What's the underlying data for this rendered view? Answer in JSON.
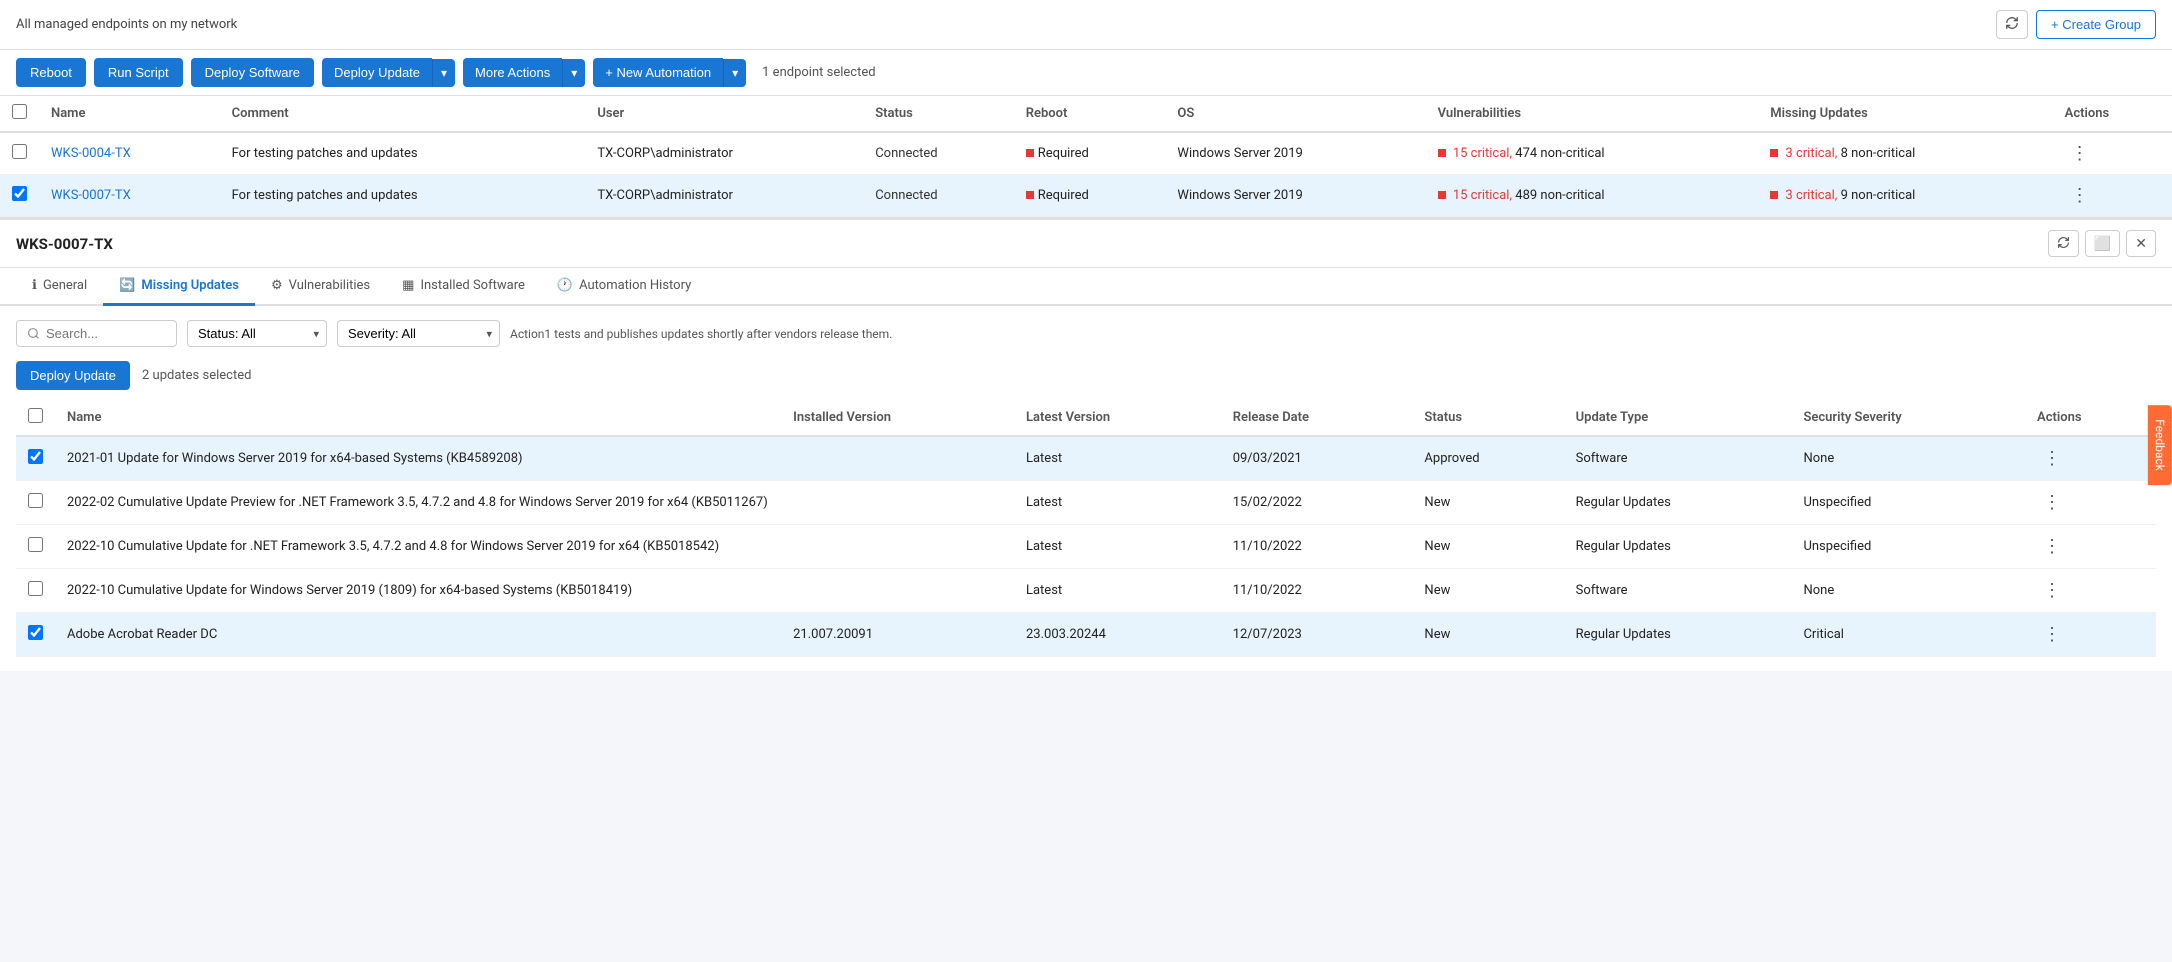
{
  "topbar": {
    "title": "All managed endpoints on my network",
    "create_group_label": "+ Create Group",
    "refresh_tooltip": "Refresh"
  },
  "toolbar": {
    "reboot_label": "Reboot",
    "run_script_label": "Run Script",
    "deploy_software_label": "Deploy Software",
    "deploy_update_label": "Deploy Update",
    "more_actions_label": "More Actions",
    "new_automation_label": "+ New Automation",
    "endpoint_selected": "1 endpoint selected"
  },
  "main_table": {
    "columns": [
      "",
      "Name",
      "Comment",
      "User",
      "Status",
      "Reboot",
      "OS",
      "Vulnerabilities",
      "Missing Updates",
      "Actions"
    ],
    "rows": [
      {
        "id": "WKS-0004-TX",
        "comment": "For testing patches and updates",
        "user": "TX-CORP\\administrator",
        "status": "Connected",
        "reboot": "Required",
        "os": "Windows Server 2019",
        "vuln_critical": "15 critical,",
        "vuln_noncritical": "474 non-critical",
        "missing_critical": "3 critical,",
        "missing_noncritical": "8 non-critical",
        "selected": false
      },
      {
        "id": "WKS-0007-TX",
        "comment": "For testing patches and updates",
        "user": "TX-CORP\\administrator",
        "status": "Connected",
        "reboot": "Required",
        "os": "Windows Server 2019",
        "vuln_critical": "15 critical,",
        "vuln_noncritical": "489 non-critical",
        "missing_critical": "3 critical,",
        "missing_noncritical": "9 non-critical",
        "selected": true
      }
    ]
  },
  "detail_panel": {
    "title": "WKS-0007-TX",
    "tabs": [
      {
        "id": "general",
        "label": "General",
        "icon": "ℹ️"
      },
      {
        "id": "missing_updates",
        "label": "Missing Updates",
        "icon": "🔄"
      },
      {
        "id": "vulnerabilities",
        "label": "Vulnerabilities",
        "icon": "⚙️"
      },
      {
        "id": "installed_software",
        "label": "Installed Software",
        "icon": "▦"
      },
      {
        "id": "automation_history",
        "label": "Automation History",
        "icon": "🕐"
      }
    ],
    "active_tab": "missing_updates",
    "search_placeholder": "Search...",
    "status_filter_label": "Status: All",
    "severity_filter_label": "Severity: All",
    "info_text": "Action1 tests and publishes updates shortly after vendors release them.",
    "deploy_update_label": "Deploy Update",
    "updates_selected_text": "2 updates selected",
    "updates_table": {
      "columns": [
        "",
        "Name",
        "Installed Version",
        "Latest Version",
        "Release Date",
        "Status",
        "Update Type",
        "Security Severity",
        "Actions"
      ],
      "rows": [
        {
          "name": "2021-01 Update for Windows Server 2019 for x64-based Systems (KB4589208)",
          "installed_version": "",
          "latest_version": "Latest",
          "release_date": "09/03/2021",
          "status": "Approved",
          "update_type": "Software",
          "security_severity": "None",
          "selected": true
        },
        {
          "name": "2022-02 Cumulative Update Preview for .NET Framework 3.5, 4.7.2 and 4.8 for Windows Server 2019 for x64 (KB5011267)",
          "installed_version": "",
          "latest_version": "Latest",
          "release_date": "15/02/2022",
          "status": "New",
          "update_type": "Regular Updates",
          "security_severity": "Unspecified",
          "selected": false
        },
        {
          "name": "2022-10 Cumulative Update for .NET Framework 3.5, 4.7.2 and 4.8 for Windows Server 2019 for x64 (KB5018542)",
          "installed_version": "",
          "latest_version": "Latest",
          "release_date": "11/10/2022",
          "status": "New",
          "update_type": "Regular Updates",
          "security_severity": "Unspecified",
          "selected": false
        },
        {
          "name": "2022-10 Cumulative Update for Windows Server 2019 (1809) for x64-based Systems (KB5018419)",
          "installed_version": "",
          "latest_version": "Latest",
          "release_date": "11/10/2022",
          "status": "New",
          "update_type": "Software",
          "security_severity": "None",
          "selected": false
        },
        {
          "name": "Adobe Acrobat Reader DC",
          "installed_version": "21.007.20091",
          "latest_version": "23.003.20244",
          "release_date": "12/07/2023",
          "status": "New",
          "update_type": "Regular Updates",
          "security_severity": "Critical",
          "selected": true
        }
      ]
    }
  },
  "feedback": {
    "label": "Feedback"
  },
  "colors": {
    "accent": "#1976d2",
    "critical": "#e53935",
    "tab_active": "#1976d2"
  }
}
